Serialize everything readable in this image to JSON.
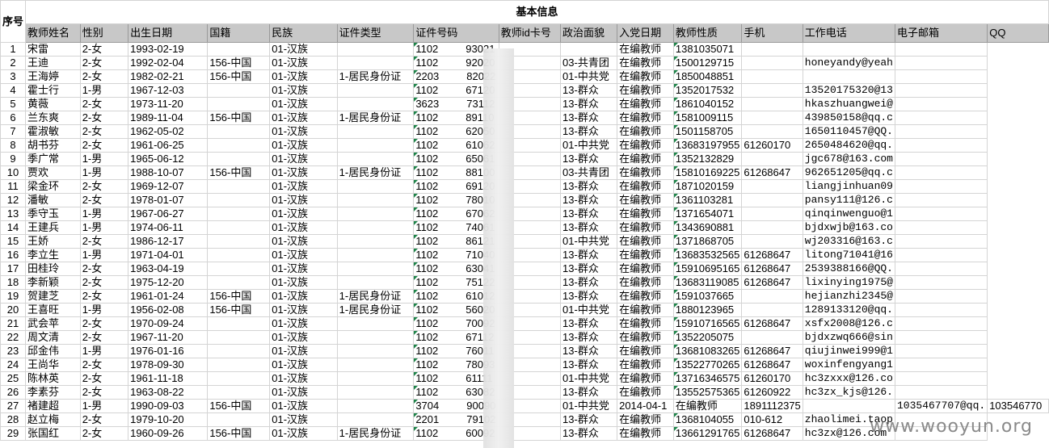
{
  "sheet": {
    "title": "基本信息",
    "seq_header": "序号",
    "columns": [
      "教师姓名",
      "性别",
      "出生日期",
      "国籍",
      "民族",
      "证件类型",
      "证件号码",
      "教师id卡号",
      "政治面貌",
      "入党日期",
      "教师性质",
      "手机",
      "工作电话",
      "电子邮箱",
      "QQ"
    ],
    "rows": [
      [
        "1",
        "宋雷",
        "2-女",
        "1993-02-19",
        "",
        "01-汉族",
        "",
        "1102",
        "93021",
        "",
        "",
        "在编教师",
        "1381035071",
        "",
        "",
        ""
      ],
      [
        "2",
        "王迪",
        "2-女",
        "1992-02-04",
        "156-中国",
        "01-汉族",
        "",
        "1102",
        "92020",
        "",
        "03-共青团",
        "在编教师",
        "1500129715",
        "",
        "honeyandy@yeah",
        ""
      ],
      [
        "3",
        "王海婷",
        "2-女",
        "1982-02-21",
        "156-中国",
        "01-汉族",
        "1-居民身份证",
        "2203",
        "82022",
        "",
        "01-中共党",
        "在编教师",
        "1850048851",
        "",
        "",
        ""
      ],
      [
        "4",
        "霍士行",
        "1-男",
        "1967-12-03",
        "",
        "01-汉族",
        "",
        "1102",
        "67120",
        "",
        "13-群众",
        "在编教师",
        "1352017532",
        "",
        "13520175320@13",
        ""
      ],
      [
        "5",
        "黄薇",
        "2-女",
        "1973-11-20",
        "",
        "01-汉族",
        "",
        "3623",
        "73112",
        "",
        "13-群众",
        "在编教师",
        "1861040152",
        "",
        "hkaszhuangwei@",
        ""
      ],
      [
        "6",
        "兰东爽",
        "2-女",
        "1989-11-04",
        "156-中国",
        "01-汉族",
        "1-居民身份证",
        "1102",
        "89110",
        "",
        "13-群众",
        "在编教师",
        "1581009115",
        "",
        "439850158@qq.c",
        ""
      ],
      [
        "7",
        "霍淑敏",
        "2-女",
        "1962-05-02",
        "",
        "01-汉族",
        "",
        "1102",
        "62050",
        "",
        "13-群众",
        "在编教师",
        "1501158705",
        "",
        "1650110457@QQ.",
        ""
      ],
      [
        "8",
        "胡书芬",
        "2-女",
        "1961-06-25",
        "",
        "01-汉族",
        "",
        "1102",
        "61062",
        "",
        "01-中共党",
        "在编教师",
        "13683197955",
        "61260170",
        "2650484620@qq.",
        ""
      ],
      [
        "9",
        "季广常",
        "1-男",
        "1965-06-12",
        "",
        "01-汉族",
        "",
        "1102",
        "65061",
        "",
        "13-群众",
        "在编教师",
        "1352132829",
        "",
        "jgc678@163.com",
        ""
      ],
      [
        "10",
        "贾欢",
        "1-男",
        "1988-10-07",
        "156-中国",
        "01-汉族",
        "1-居民身份证",
        "1102",
        "88100",
        "",
        "03-共青团",
        "在编教师",
        "15810169225",
        "61268647",
        "962651205@qq.c",
        ""
      ],
      [
        "11",
        "梁金环",
        "2-女",
        "1969-12-07",
        "",
        "01-汉族",
        "",
        "1102",
        "69120",
        "",
        "13-群众",
        "在编教师",
        "1871020159",
        "",
        "liangjinhuan09",
        ""
      ],
      [
        "12",
        "潘敏",
        "2-女",
        "1978-01-07",
        "",
        "01-汉族",
        "",
        "1102",
        "78010",
        "",
        "13-群众",
        "在编教师",
        "1361103281",
        "",
        "pansy111@126.c",
        ""
      ],
      [
        "13",
        "季守玉",
        "1-男",
        "1967-06-27",
        "",
        "01-汉族",
        "",
        "1102",
        "67062",
        "",
        "13-群众",
        "在编教师",
        "1371654071",
        "",
        "qinqinwenguo@1",
        ""
      ],
      [
        "14",
        "王建兵",
        "1-男",
        "1974-06-11",
        "",
        "01-汉族",
        "",
        "1102",
        "74061",
        "",
        "13-群众",
        "在编教师",
        "1343690881",
        "",
        "bjdxwjb@163.co",
        ""
      ],
      [
        "15",
        "王娇",
        "2-女",
        "1986-12-17",
        "",
        "01-汉族",
        "",
        "1102",
        "86121",
        "",
        "01-中共党",
        "在编教师",
        "1371868705",
        "",
        "wj203316@163.c",
        ""
      ],
      [
        "16",
        "李立生",
        "1-男",
        "1971-04-01",
        "",
        "01-汉族",
        "",
        "1102",
        "71040",
        "",
        "13-群众",
        "在编教师",
        "13683532565",
        "61268647",
        "litong71041@16",
        ""
      ],
      [
        "17",
        "田桂玲",
        "2-女",
        "1963-04-19",
        "",
        "01-汉族",
        "",
        "1102",
        "63041",
        "",
        "13-群众",
        "在编教师",
        "15910695165",
        "61268647",
        "2539388166@QQ.",
        ""
      ],
      [
        "18",
        "李新颖",
        "2-女",
        "1975-12-20",
        "",
        "01-汉族",
        "",
        "1102",
        "75122",
        "",
        "13-群众",
        "在编教师",
        "13683119085",
        "61268647",
        "lixinying1975@",
        ""
      ],
      [
        "19",
        "贺建芝",
        "2-女",
        "1961-01-24",
        "156-中国",
        "01-汉族",
        "1-居民身份证",
        "1102",
        "61012",
        "",
        "13-群众",
        "在编教师",
        "1591037665",
        "",
        "hejianzhi2345@",
        ""
      ],
      [
        "20",
        "王喜旺",
        "1-男",
        "1956-02-08",
        "156-中国",
        "01-汉族",
        "1-居民身份证",
        "1102",
        "56020",
        "",
        "01-中共党",
        "在编教师",
        "1880123965",
        "",
        "1289133120@qq.",
        ""
      ],
      [
        "21",
        "武会苹",
        "2-女",
        "1970-09-24",
        "",
        "01-汉族",
        "",
        "1102",
        "70092",
        "",
        "13-群众",
        "在编教师",
        "15910716565",
        "61268647",
        "xsfx2008@126.c",
        ""
      ],
      [
        "22",
        "周文清",
        "2-女",
        "1967-11-20",
        "",
        "01-汉族",
        "",
        "1102",
        "67112",
        "",
        "13-群众",
        "在编教师",
        "1352205075",
        "",
        "bjdxzwq666@sin",
        ""
      ],
      [
        "23",
        "邱金伟",
        "1-男",
        "1976-01-16",
        "",
        "01-汉族",
        "",
        "1102",
        "76011",
        "",
        "13-群众",
        "在编教师",
        "13681083265",
        "61268647",
        "qiujinwei999@1",
        ""
      ],
      [
        "24",
        "王尚华",
        "2-女",
        "1978-09-30",
        "",
        "01-汉族",
        "",
        "1102",
        "78093",
        "",
        "13-群众",
        "在编教师",
        "13522770265",
        "61268647",
        "woxinfengyang1",
        ""
      ],
      [
        "25",
        "陈林英",
        "2-女",
        "1961-11-18",
        "",
        "01-汉族",
        "",
        "1102",
        "61111",
        "",
        "01-中共党",
        "在编教师",
        "13716346575",
        "61260170",
        "hc3zxxx@126.co",
        ""
      ],
      [
        "26",
        "李素芬",
        "2-女",
        "1963-08-22",
        "",
        "01-汉族",
        "",
        "1102",
        "63082",
        "",
        "13-群众",
        "在编教师",
        "13552575365",
        "61260922",
        "hc3zx_kjs@126.",
        ""
      ],
      [
        "27",
        "褚建超",
        "1-男",
        "1990-09-03",
        "156-中国",
        "01-汉族",
        "",
        "3704",
        "90090",
        "",
        "01-中共党",
        "2014-04-1",
        "在编教师",
        "1891112375",
        "",
        "1035467707@qq.",
        "103546770"
      ],
      [
        "28",
        "赵立梅",
        "2-女",
        "1979-10-20",
        "",
        "01-汉族",
        "",
        "2201",
        "79102",
        "",
        "13-群众",
        "在编教师",
        "1368104055",
        "010-612",
        "zhaolimei.taop",
        ""
      ],
      [
        "29",
        "张国红",
        "2-女",
        "1960-09-26",
        "156-中国",
        "01-汉族",
        "1-居民身份证",
        "1102",
        "60092",
        "",
        "13-群众",
        "在编教师",
        "13661291765",
        "61268647",
        "hc3zx@126.com",
        ""
      ]
    ],
    "watermark": "www.wooyun.org"
  }
}
